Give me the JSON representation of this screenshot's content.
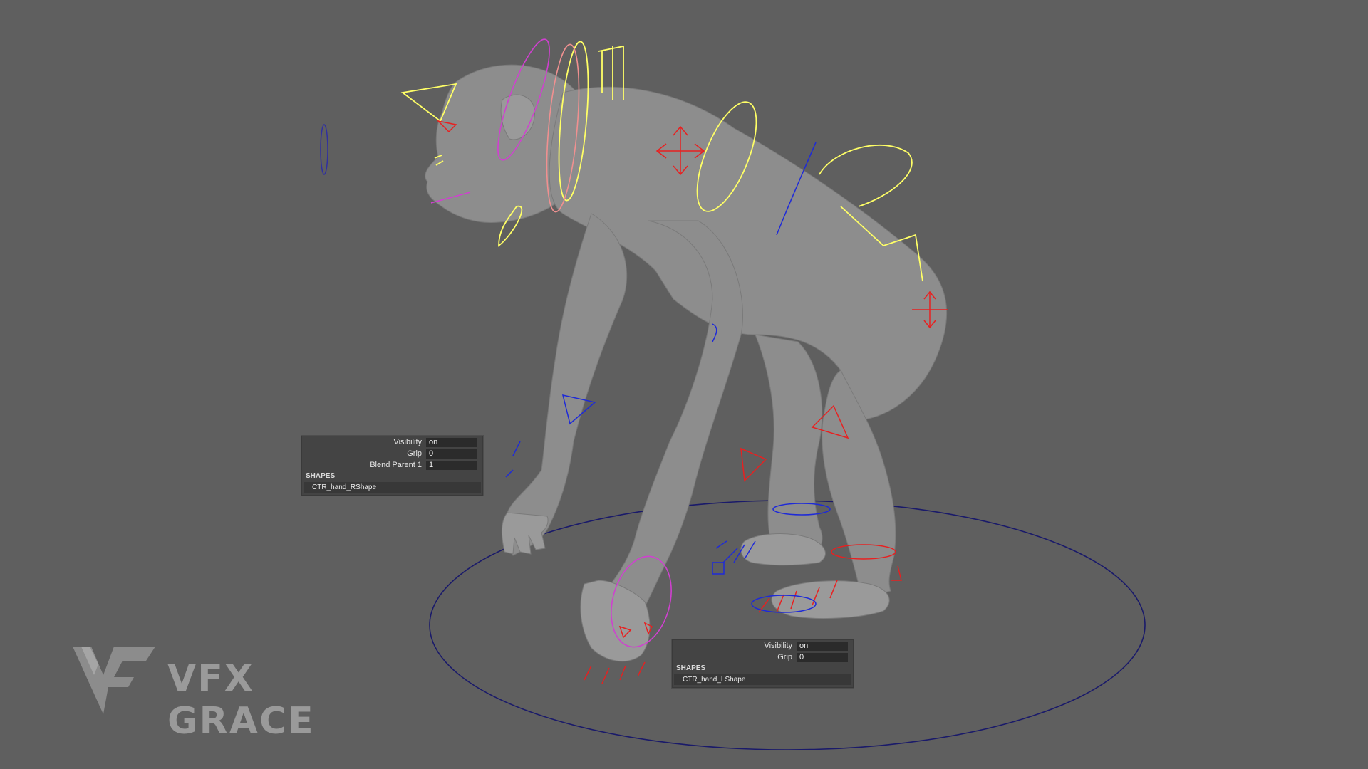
{
  "viewport": {
    "background": "#5f5f5f",
    "colors": {
      "yellow_control": "#ffff66",
      "red_control": "#e82020",
      "blue_control": "#1e2ad8",
      "magenta_control": "#d040d0",
      "pink_control": "#f09090",
      "orange_control": "#f0a020",
      "ground_circle": "#1a1a6a"
    }
  },
  "channel_box_right_hand": {
    "attributes": [
      {
        "label": "Visibility",
        "value": "on"
      },
      {
        "label": "Grip",
        "value": "0"
      },
      {
        "label": "Blend Parent 1",
        "value": "1"
      }
    ],
    "shapes_header": "SHAPES",
    "shape_name": "CTR_hand_RShape"
  },
  "channel_box_left_hand": {
    "attributes": [
      {
        "label": "Visibility",
        "value": "on"
      },
      {
        "label": "Grip",
        "value": "0"
      }
    ],
    "shapes_header": "SHAPES",
    "shape_name": "CTR_hand_LShape"
  },
  "watermark": {
    "text": "VFX GRACE",
    "logo_icon": "vg-logo-icon"
  }
}
